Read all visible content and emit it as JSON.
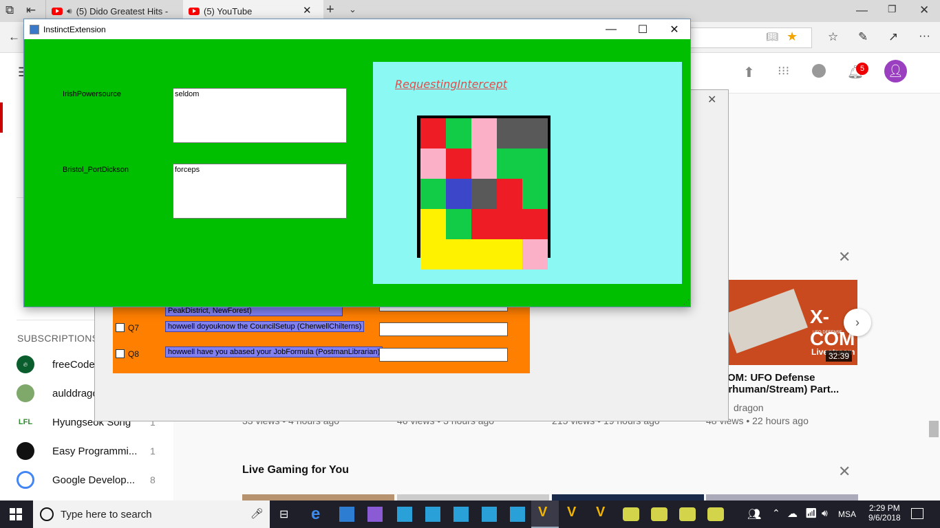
{
  "browser": {
    "tabs": [
      {
        "title": "(5) Dido Greatest Hits -",
        "icon": "youtube-icon",
        "audio": true
      },
      {
        "title": "(5) YouTube",
        "icon": "youtube-icon"
      }
    ]
  },
  "youtube": {
    "notification_count": "5",
    "sidebar": {
      "subscriptions_heading": "SUBSCRIPTIONS",
      "items": [
        {
          "name": "freeCodeC",
          "count": "",
          "avatar": "freecodecamp-avatar"
        },
        {
          "name": "aulddrago",
          "count": "",
          "avatar": "auld-dragon-avatar"
        },
        {
          "name": "Hyungseok Song",
          "count": "1",
          "avatar": "LFL"
        },
        {
          "name": "Easy Programmi...",
          "count": "1",
          "avatar": "easy-programming-avatar"
        },
        {
          "name": "Google Develop...",
          "count": "8",
          "avatar": "google-developers-avatar"
        }
      ]
    },
    "video_meta": [
      "33 views • 4 hours ago",
      "46 views • 3 hours ago",
      "215 views • 19 hours ago",
      "48 views • 22 hours ago"
    ],
    "featured_video": {
      "title_line1": "OM: UFO Defense",
      "title_line2": "erhuman/Stream) Part...",
      "channel": "dragon",
      "duration": "32:39",
      "thumb_text": "X-COM",
      "thumb_sub": "UFO DEFENSE",
      "thumb_live": "Livestream"
    },
    "section_title": "Live Gaming for You"
  },
  "old_dialog": {
    "rows": [
      {
        "label": "",
        "question": "PeakDistrict, NewForest)"
      },
      {
        "label": "Q7",
        "question": "howwell doyouknow the CouncilSetup (CherwellChilterns)"
      },
      {
        "label": "Q8",
        "question": "howwell have you abased your JobFormula (PostmanLibrarian)"
      }
    ]
  },
  "window": {
    "title": "InstinctExtension",
    "field1": {
      "label": "IrishPowersource",
      "value": "seldom"
    },
    "field2": {
      "label": "Bristol_PortDickson",
      "value": "forceps"
    },
    "panel_title": "RequestingIntercept",
    "grid": [
      [
        "red",
        "green",
        "pink",
        "gray",
        "gray"
      ],
      [
        "pink",
        "red",
        "pink",
        "green",
        "green"
      ],
      [
        "green",
        "blue",
        "gray",
        "red",
        "green"
      ],
      [
        "yellow",
        "green",
        "red",
        "red",
        "red"
      ],
      [
        "yellow",
        "yellow",
        "yellow",
        "yellow",
        "pink"
      ]
    ],
    "colors": {
      "red": "#ee1c24",
      "green": "#12cb47",
      "pink": "#fcb0c7",
      "gray": "#595959",
      "blue": "#3c46c8",
      "yellow": "#fff200",
      "background": "#00bf00",
      "panel": "#8cf8f4"
    }
  },
  "taskbar": {
    "search_placeholder": "Type here to search",
    "language": "MSA",
    "time": "2:29 PM",
    "date": "9/6/2018"
  }
}
